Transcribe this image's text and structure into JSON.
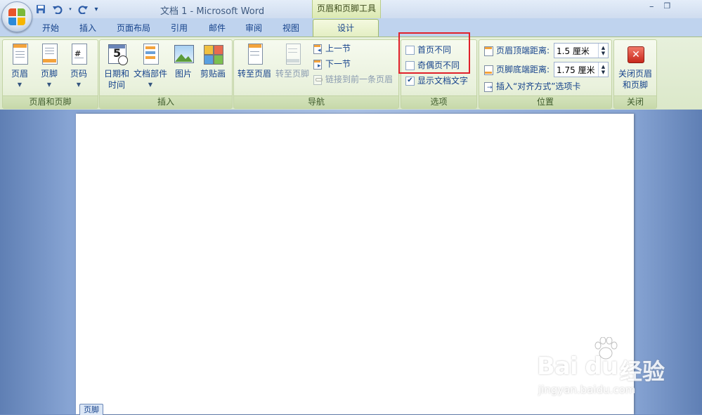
{
  "window": {
    "title": "文档 1 - Microsoft Word",
    "context_tab_title": "页眉和页脚工具",
    "controls": {
      "minimize": "–",
      "restore": "❐"
    }
  },
  "qat": {
    "save_icon": "save-icon",
    "undo_icon": "undo-icon",
    "redo_icon": "redo-icon",
    "customize": "▾"
  },
  "tabs": [
    {
      "label": "开始"
    },
    {
      "label": "插入"
    },
    {
      "label": "页面布局"
    },
    {
      "label": "引用"
    },
    {
      "label": "邮件"
    },
    {
      "label": "审阅"
    },
    {
      "label": "视图"
    },
    {
      "label": "设计",
      "active": true
    }
  ],
  "groups": {
    "header_footer": {
      "label": "页眉和页脚",
      "header": "页眉",
      "footer": "页脚",
      "page_number": "页码"
    },
    "insert": {
      "label": "插入",
      "datetime_line1": "日期和",
      "datetime_line2": "时间",
      "quickparts": "文档部件",
      "picture": "图片",
      "clipart": "剪贴画"
    },
    "navigation": {
      "label": "导航",
      "goto_header": "转至页眉",
      "goto_footer": "转至页脚",
      "prev_section": "上一节",
      "next_section": "下一节",
      "link_previous": "链接到前一条页眉"
    },
    "options": {
      "label": "选项",
      "different_first_page": "首页不同",
      "different_odd_even": "奇偶页不同",
      "show_document_text": "显示文档文字",
      "different_first_page_checked": false,
      "different_odd_even_checked": false,
      "show_document_text_checked": true
    },
    "position": {
      "label": "位置",
      "header_from_top_label": "页眉顶端距离:",
      "header_from_top_value": "1.5 厘米",
      "footer_from_bottom_label": "页脚底端距离:",
      "footer_from_bottom_value": "1.75 厘米",
      "insert_alignment_tab": "插入“对齐方式”选项卡"
    },
    "close": {
      "label": "关闭",
      "close_line1": "关闭页眉",
      "close_line2": "和页脚"
    }
  },
  "document": {
    "footer_tag": "页脚"
  },
  "watermark": {
    "brand": "Bai du",
    "cn": "经验",
    "url": "jingyan.baidu.com"
  },
  "colors": {
    "highlight": "#e0202a",
    "context_tab": "#dbe9b2",
    "ribbon": "#e9f1dc"
  }
}
